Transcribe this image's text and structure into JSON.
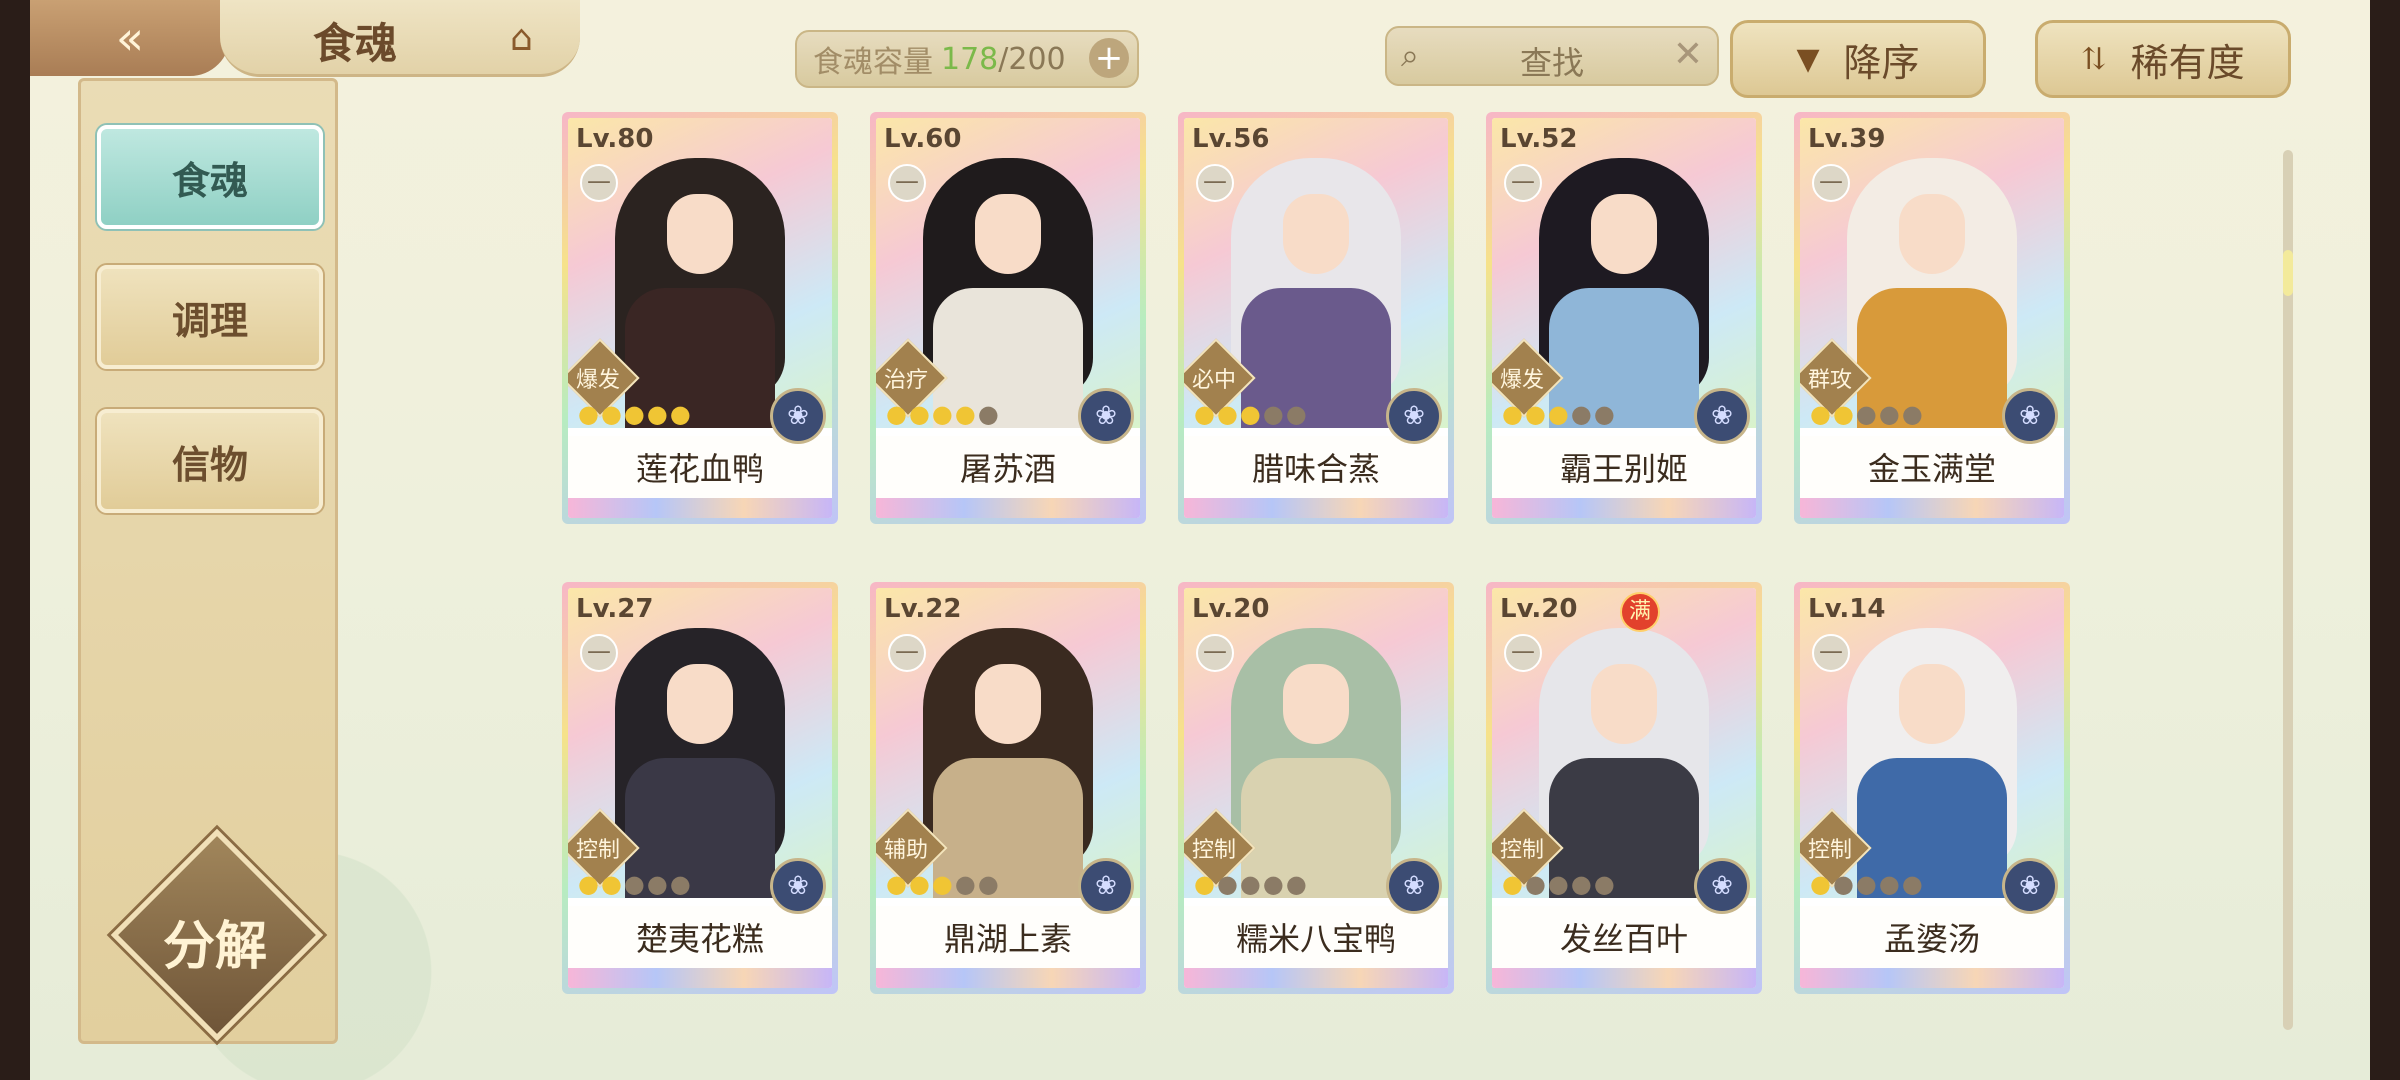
{
  "header": {
    "back_icon": "double-chevron-left-icon",
    "title": "食魂",
    "title_icon": "pavilion-icon",
    "capacity_label": "食魂容量",
    "capacity_value": "178",
    "capacity_slash": "/",
    "capacity_max": "200",
    "capacity_plus": "+",
    "search_placeholder": "查找",
    "search_clear": "✕",
    "sort_order_label": "降序",
    "sort_field_label": "稀有度"
  },
  "sidebar": {
    "items": [
      {
        "label": "食魂",
        "active": true
      },
      {
        "label": "调理",
        "active": false
      },
      {
        "label": "信物",
        "active": false
      }
    ],
    "decompose_label": "分解"
  },
  "colors": {
    "accent_teal": "#8fd0c4",
    "gold": "#f0c534",
    "capacity_green": "#7bb94a"
  },
  "cards": [
    {
      "level": "Lv.80",
      "name": "莲花血鸭",
      "role": "爆发",
      "stars_filled": 5,
      "stars_total": 5,
      "hair": "#2b2320",
      "body": "#3a2624",
      "full": false
    },
    {
      "level": "Lv.60",
      "name": "屠苏酒",
      "role": "治疗",
      "stars_filled": 4,
      "stars_total": 5,
      "hair": "#1f1b1c",
      "body": "#e9e4da",
      "full": false
    },
    {
      "level": "Lv.56",
      "name": "腊味合蒸",
      "role": "必中",
      "stars_filled": 3,
      "stars_total": 5,
      "hair": "#e8e6ea",
      "body": "#6a5a8c",
      "full": false
    },
    {
      "level": "Lv.52",
      "name": "霸王别姬",
      "role": "爆发",
      "stars_filled": 3,
      "stars_total": 5,
      "hair": "#1e1a22",
      "body": "#8fb6d8",
      "full": false
    },
    {
      "level": "Lv.39",
      "name": "金玉满堂",
      "role": "群攻",
      "stars_filled": 2,
      "stars_total": 5,
      "hair": "#f3ece4",
      "body": "#d89a3a",
      "full": false
    },
    {
      "level": "Lv.27",
      "name": "楚夷花糕",
      "role": "控制",
      "stars_filled": 2,
      "stars_total": 5,
      "hair": "#262328",
      "body": "#3a3846",
      "full": false
    },
    {
      "level": "Lv.22",
      "name": "鼎湖上素",
      "role": "辅助",
      "stars_filled": 3,
      "stars_total": 5,
      "hair": "#3a2a20",
      "body": "#c7b08a",
      "full": false
    },
    {
      "level": "Lv.20",
      "name": "糯米八宝鸭",
      "role": "控制",
      "stars_filled": 1,
      "stars_total": 5,
      "hair": "#a8bfa6",
      "body": "#d9d2b0",
      "full": false
    },
    {
      "level": "Lv.20",
      "name": "发丝百叶",
      "role": "控制",
      "stars_filled": 1,
      "stars_total": 5,
      "hair": "#e6e6ea",
      "body": "#3b3b45",
      "full": true,
      "full_label": "满"
    },
    {
      "level": "Lv.14",
      "name": "孟婆汤",
      "role": "控制",
      "stars_filled": 1,
      "stars_total": 5,
      "hair": "#f0eeee",
      "body": "#3f6aa8",
      "full": false
    }
  ],
  "card_minus_glyph": "—",
  "card_emblem_icon": "flower-emblem-icon",
  "star_icon": "flame-star-icon"
}
